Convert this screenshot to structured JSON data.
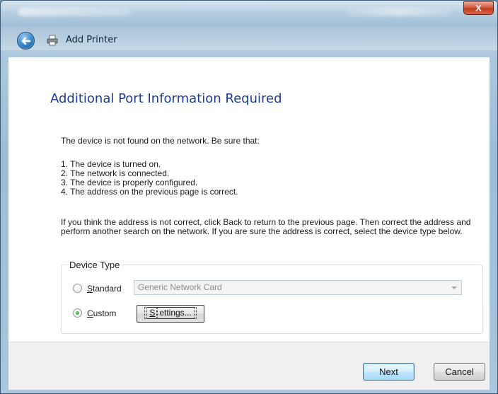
{
  "window": {
    "close_label": "X"
  },
  "nav": {
    "title": "Add Printer"
  },
  "content": {
    "heading": "Additional Port Information Required",
    "intro": "The device is not found on the network.  Be sure that:",
    "list": [
      "1.  The device is turned on.",
      "2.  The network is connected.",
      "3.  The device is properly configured.",
      "4.  The address on the previous page is correct."
    ],
    "paragraph": "If you think the address is not correct, click Back to return to the previous page.  Then correct the address and perform another search on the network.  If you are sure the address is correct, select the device type below."
  },
  "device_type": {
    "label": "Device Type",
    "standard": {
      "mnemonic": "S",
      "rest": "tandard",
      "selected": false
    },
    "custom": {
      "mnemonic": "C",
      "rest": "ustom",
      "selected": true
    },
    "dropdown_value": "Generic Network Card",
    "settings": {
      "mnemonic": "S",
      "rest": "ettings..."
    }
  },
  "footer": {
    "next_label": "Next",
    "cancel_label": "Cancel"
  }
}
